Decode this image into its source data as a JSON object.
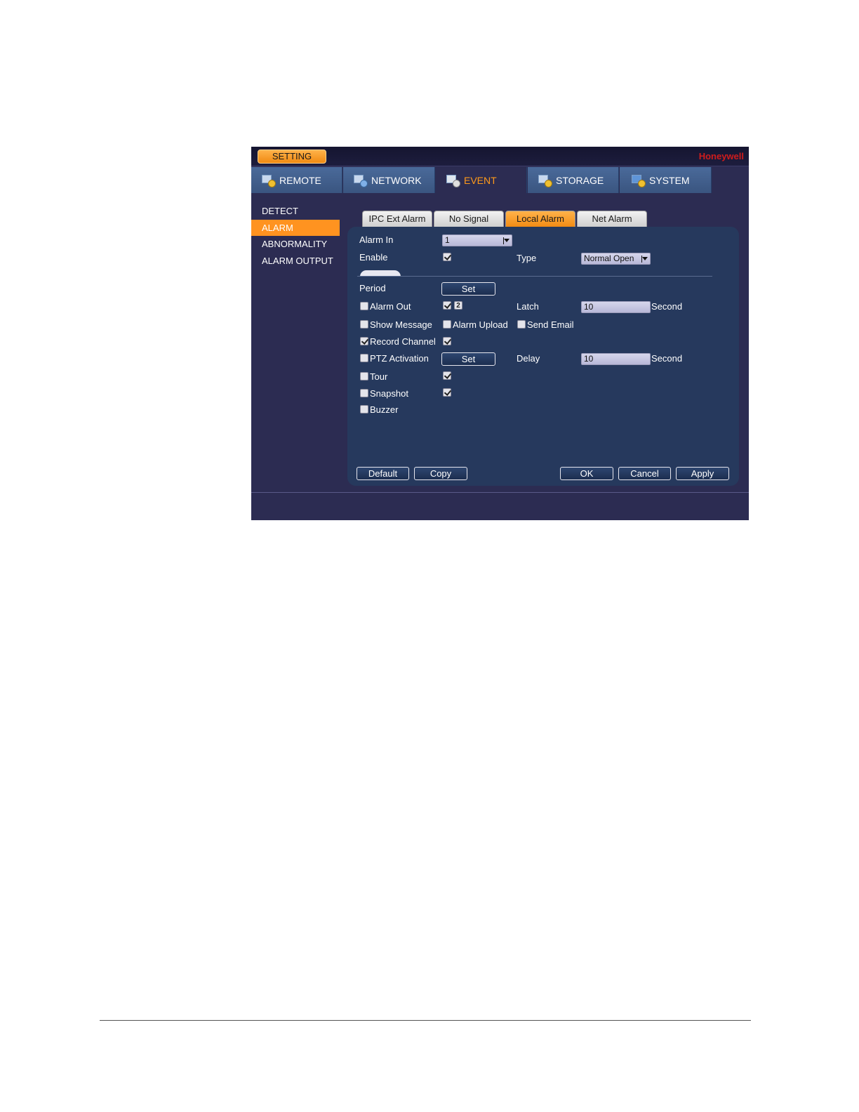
{
  "header": {
    "setting_label": "SETTING",
    "brand": "Honeywell"
  },
  "main_tabs": [
    {
      "label": "REMOTE",
      "icon": "remote-icon"
    },
    {
      "label": "NETWORK",
      "icon": "network-icon"
    },
    {
      "label": "EVENT",
      "icon": "event-icon"
    },
    {
      "label": "STORAGE",
      "icon": "storage-icon"
    },
    {
      "label": "SYSTEM",
      "icon": "system-icon"
    }
  ],
  "active_main_tab": "EVENT",
  "sidebar": {
    "items": [
      "DETECT",
      "ALARM",
      "ABNORMALITY",
      "ALARM OUTPUT"
    ],
    "active": "ALARM"
  },
  "sub_tabs": {
    "items": [
      "IPC Ext Alarm",
      "No Signal",
      "Local Alarm",
      "Net Alarm"
    ],
    "active": "Local Alarm"
  },
  "form": {
    "alarm_in_label": "Alarm In",
    "alarm_in_value": "1",
    "enable_label": "Enable",
    "enable_checked": true,
    "type_label": "Type",
    "type_value": "Normal Open",
    "period_label": "Period",
    "set_label": "Set",
    "alarm_out_label": "Alarm Out",
    "alarm_out_checked": false,
    "alarm_out_channel_badge": "2",
    "latch_label": "Latch",
    "latch_value": "10",
    "second_label": "Second",
    "show_message_label": "Show Message",
    "alarm_upload_label": "Alarm Upload",
    "send_email_label": "Send Email",
    "record_channel_label": "Record Channel",
    "record_channel_checked": true,
    "ptz_activation_label": "PTZ Activation",
    "delay_label": "Delay",
    "delay_value": "10",
    "tour_label": "Tour",
    "snapshot_label": "Snapshot",
    "buzzer_label": "Buzzer"
  },
  "buttons": {
    "default": "Default",
    "copy": "Copy",
    "ok": "OK",
    "cancel": "Cancel",
    "apply": "Apply"
  },
  "colors": {
    "accent": "#ff9320",
    "background": "#2c2c52",
    "panel": "#26395d",
    "tab_bar": "#4a6a9a",
    "brand": "#d01c1c"
  }
}
